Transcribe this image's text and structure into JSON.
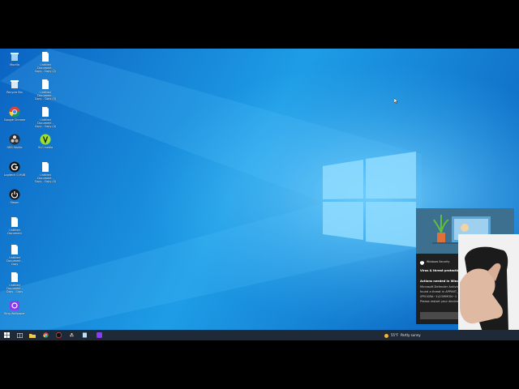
{
  "desktop": {
    "icons": [
      {
        "label": "Mozilla",
        "icon": "recycle-bin-icon"
      },
      {
        "label": "Recycle Bin",
        "icon": "recycle-bin-full-icon"
      },
      {
        "label": "Google Chrome",
        "icon": "chrome-icon"
      },
      {
        "label": "OBS Studio",
        "icon": "obs-icon"
      },
      {
        "label": "Logitech G HUB",
        "icon": "logitech-icon"
      },
      {
        "label": "Steam",
        "icon": "power-app-icon"
      },
      {
        "label": "Untitled Document",
        "icon": "document-icon"
      },
      {
        "label": "Untitled Document - Copy",
        "icon": "document-icon"
      },
      {
        "label": "Untitled Document - Copy - Copy",
        "icon": "document-icon"
      },
      {
        "label": "Bing Wallpaper",
        "icon": "purple-app-icon"
      },
      {
        "label": "Untitled Document - Copy - Copy (2)",
        "icon": "document-icon"
      },
      {
        "label": "Untitled Document - Copy - Copy (3)",
        "icon": "document-icon"
      },
      {
        "label": "Untitled Document - Copy - Copy (4)",
        "icon": "document-icon"
      },
      {
        "label": "VLC media",
        "icon": "vlc-icon"
      },
      {
        "label": "Untitled Document - Copy - Copy (5)",
        "icon": "document-icon"
      }
    ]
  },
  "notification": {
    "app_name": "Windows Security",
    "title": "Virus & threat protection",
    "heading": "Actions needed in Windows Security",
    "line1": "Microsoft Defender Antivirus",
    "line2": "found a threat in APPINIT_DLLS",
    "line3": "\\PROGRA~1\\COMMON~1",
    "line4": "Please restart your device",
    "button": "Dismiss"
  },
  "taskbar": {
    "weather_temp": "55°F",
    "weather_text": "Partly sunny"
  },
  "colors": {
    "wallpaper_dark": "#0a5fb4",
    "wallpaper_light": "#2fb6f5",
    "taskbar": "#1f2a38",
    "toast_bg": "#1f1f1f"
  }
}
